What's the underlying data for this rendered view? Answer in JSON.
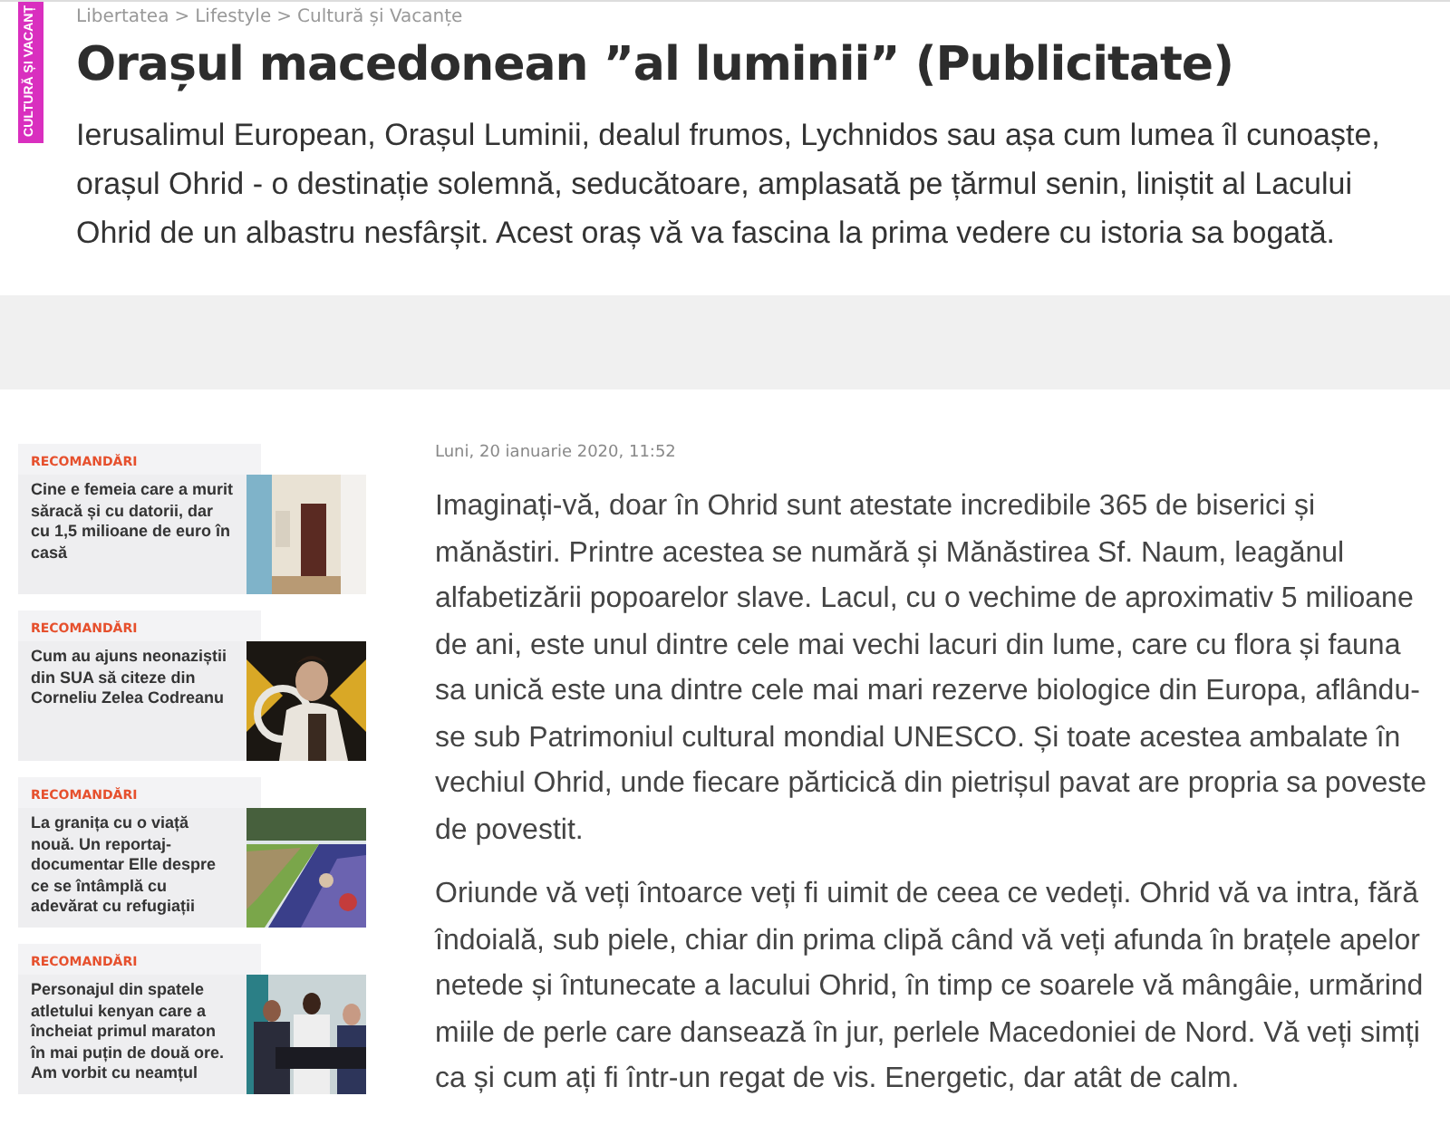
{
  "section_tag": "CULTURĂ ȘI VACANȚ",
  "breadcrumb": [
    "Libertatea",
    "Lifestyle",
    "Cultură și Vacanțe"
  ],
  "breadcrumb_separator": ">",
  "title": "Orașul macedonean ”al luminii” (Publicitate)",
  "lead": "Ierusalimul European, Orașul Luminii, dealul frumos, Lychnidos sau așa cum lumea îl cunoaște, orașul Ohrid - o destinație solemnă, seducătoare, amplasată pe țărmul senin, liniștit al Lacului Ohrid de un albastru nesfârșit. Acest oraș vă va fascina la prima vedere cu istoria sa bogată.",
  "recommendations": [
    {
      "label": "RECOMANDĂRI",
      "title": "Cine e femeia care a murit săracă și cu datorii, dar cu 1,5 milioane de euro în casă",
      "kind": "picture"
    },
    {
      "label": "RECOMANDĂRI",
      "title": "Cum au ajuns neonaziștii din SUA să citeze din Corneliu Zelea Codreanu",
      "kind": "picture"
    },
    {
      "label": "RECOMANDĂRI",
      "title": "La granița cu o viață nouă. Un reportaj-documentar Elle despre ce se întâmplă cu adevărat cu refugiații",
      "kind": "picture"
    },
    {
      "label": "RECOMANDĂRI",
      "title": "Personajul din spatele atletului kenyan care a încheiat primul maraton în mai puțin de două ore. Am vorbit cu neamțul",
      "kind": "picture"
    }
  ],
  "article": {
    "date": "Luni, 20 ianuarie 2020, 11:52",
    "paragraphs": [
      "Imaginați-vă, doar în Ohrid sunt atestate incredibile 365 de biserici și mănăstiri. Printre acestea se numără și Mănăstirea Sf. Naum, leagănul alfabetizării popoarelor slave. Lacul, cu o vechime de aproximativ 5 milioane de ani, este unul dintre cele mai vechi lacuri din lume, care cu flora și fauna sa unică este una dintre cele mai mari rezerve biologice din Europa, aflându-se sub Patrimoniul cultural mondial UNESCO. Și toate acestea ambalate în vechiul Ohrid, unde fiecare părticică din pietrișul pavat are propria sa poveste de povestit.",
      "Oriunde vă veți întoarce veți fi uimit de ceea ce vedeți. Ohrid vă va intra, fără îndoială, sub piele, chiar din prima clipă când vă veți afunda în brațele apelor netede și întunecate a lacului Ohrid, în timp ce soarele vă mângâie, urmărind miile de perle care dansează în jur, perlele Macedoniei de Nord. Vă veți simți ca și cum ați fi într-un regat de vis. Energetic, dar atât de calm."
    ]
  }
}
